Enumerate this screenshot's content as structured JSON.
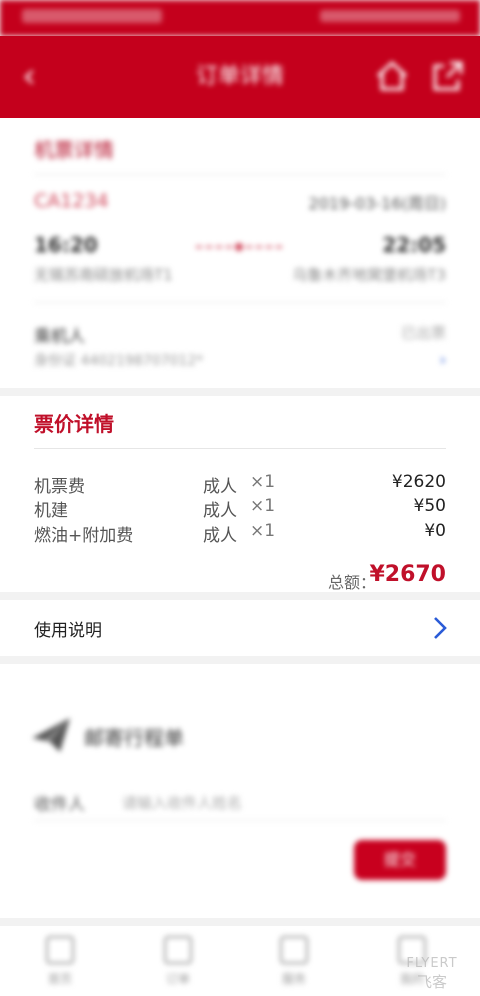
{
  "nav": {
    "title": "订单详情",
    "back_icon": "back-arrow-icon",
    "home_icon": "home-icon",
    "share_icon": "share-icon"
  },
  "ticket": {
    "section_title": "机票详情",
    "flight_no": "CA1234",
    "date": "2019-03-16(周日)",
    "dep_time": "16:20",
    "arr_time": "22:05",
    "dep_airport": "无锡苏南硕放机场T1",
    "arr_airport": "乌鲁木齐地窝堡机场T3",
    "passenger_name": "乘机人",
    "passenger_id": "身份证 4402198707012*",
    "passenger_status": "已出票"
  },
  "price": {
    "title": "票价详情",
    "rows": [
      {
        "name": "机票费",
        "type": "成人",
        "qty": "×1",
        "amount": "¥2620"
      },
      {
        "name": "机建",
        "type": "成人",
        "qty": "×1",
        "amount": "¥50"
      },
      {
        "name": "燃油+附加费",
        "type": "成人",
        "qty": "×1",
        "amount": "¥0"
      }
    ],
    "total_label": "总额：",
    "total_value": "¥2670"
  },
  "usage": {
    "label": "使用说明"
  },
  "mail": {
    "title": "邮寄行程单",
    "recipient_label": "收件人",
    "recipient_placeholder": "请输入收件人姓名",
    "submit_label": "提交"
  },
  "tabs": [
    {
      "label": "首页"
    },
    {
      "label": "订单"
    },
    {
      "label": "服务"
    },
    {
      "label": "我的"
    }
  ],
  "watermark": {
    "line1": "FLYERT",
    "line2": "飞客"
  },
  "colors": {
    "brand": "#c4001c",
    "price": "#c0102a",
    "link": "#2a5bd7"
  }
}
